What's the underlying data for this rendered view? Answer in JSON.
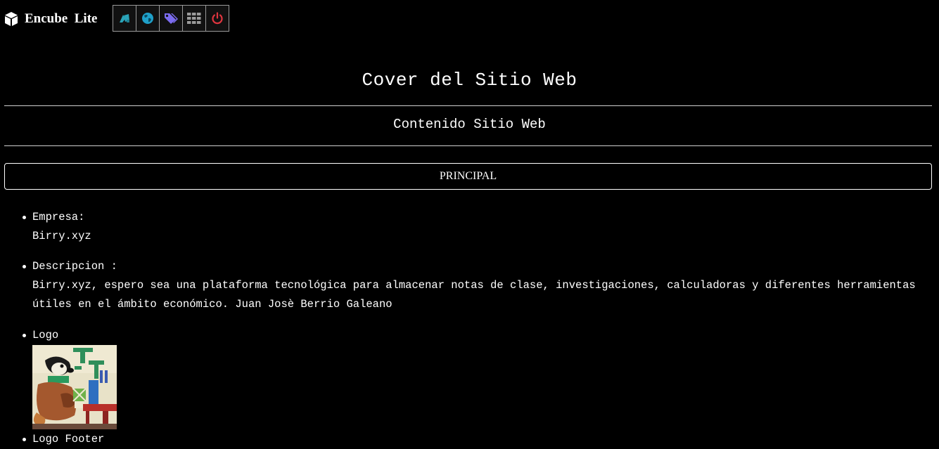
{
  "app": {
    "brand_name": "Encube  Lite"
  },
  "toolbar": {
    "buttons": [
      {
        "icon": "shapes-icon",
        "color": "#2aa3b8"
      },
      {
        "icon": "globe-icon",
        "color": "#1fa0c9"
      },
      {
        "icon": "tags-icon",
        "color": "#7b6cf0"
      },
      {
        "icon": "grid-icon",
        "color": "#9a9a9a"
      },
      {
        "icon": "power-icon",
        "color": "#e0353f"
      }
    ]
  },
  "main": {
    "cover_title": "Cover del Sitio Web",
    "content_title": "Contenido Sitio Web",
    "principal_label": "PRINCIPAL",
    "items": {
      "empresa_label": "Empresa:",
      "empresa_value": "Birry.xyz",
      "descripcion_label": "Descripcion :",
      "descripcion_value": "Birry.xyz, espero sea una plataforma tecnológica para almacenar notas de clase, investigaciones, calculadoras y diferentes herramientas útiles en el ámbito económico. Juan Josè Berrio Galeano",
      "logo_label": "Logo",
      "logo_footer_label": "Logo Footer"
    }
  }
}
